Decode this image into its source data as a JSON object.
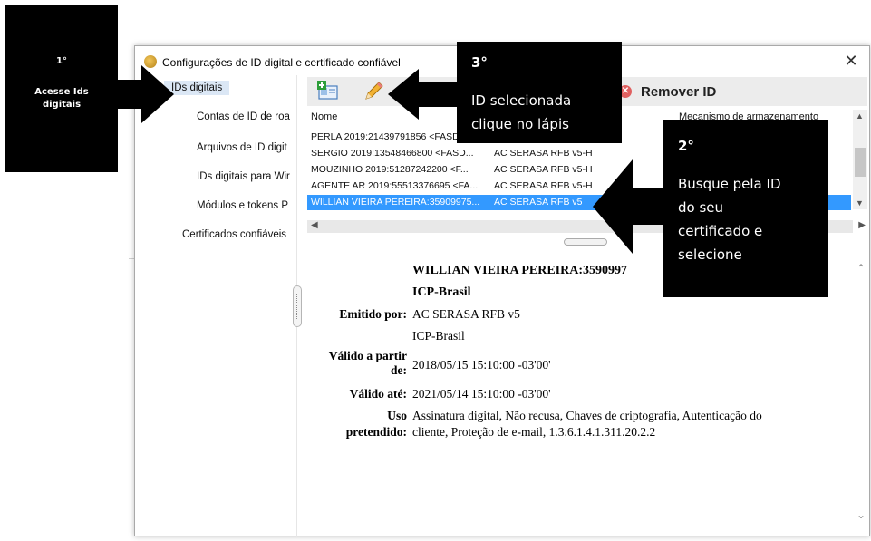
{
  "dialog": {
    "title": "Configurações de ID digital e certificado confiável",
    "close_label": "✕"
  },
  "nav": {
    "items": [
      {
        "label": "IDs digitais",
        "selected": true
      },
      {
        "label": "Contas de ID de roa"
      },
      {
        "label": "Arquivos de ID digit"
      },
      {
        "label": "IDs digitais para Wir"
      },
      {
        "label": "Módulos e tokens P"
      },
      {
        "label": "Certificados confiáveis"
      }
    ]
  },
  "toolbar": {
    "add_icon": "add-id-icon",
    "edit_icon": "pencil-icon",
    "remove_label": "Remover ID",
    "remove_icon": "x-circle-icon"
  },
  "list": {
    "columns": [
      "Nome",
      "Mecanismo de armazenamento"
    ],
    "rows": [
      {
        "name": "PERLA 2019:21439791856 <FASD...",
        "issuer": ""
      },
      {
        "name": "SERGIO 2019:13548466800 <FASD...",
        "issuer": "AC SERASA RFB v5-H"
      },
      {
        "name": "MOUZINHO 2019:51287242200 <F...",
        "issuer": "AC SERASA RFB v5-H"
      },
      {
        "name": "AGENTE AR 2019:55513376695 <FA...",
        "issuer": "AC SERASA RFB v5-H"
      },
      {
        "name": "WILLIAN VIEIRA PEREIRA:35909975...",
        "issuer": "AC SERASA RFB v5",
        "selected": true
      }
    ]
  },
  "details": {
    "name": "WILLIAN VIEIRA PEREIRA:3590997",
    "org": "ICP-Brasil",
    "issued_by_label": "Emitido por:",
    "issued_by_1": "AC SERASA RFB v5",
    "issued_by_2": "ICP-Brasil",
    "valid_from_label_1": "Válido a partir",
    "valid_from_label_2": "de:",
    "valid_from": "2018/05/15 15:10:00 -03'00'",
    "valid_to_label": "Válido até:",
    "valid_to": "2021/05/14 15:10:00 -03'00'",
    "usage_label_1": "Uso",
    "usage_label_2": "pretendido:",
    "usage_1": "Assinatura digital, Não recusa, Chaves de criptografia, Autenticação do",
    "usage_2": "cliente, Proteção de e-mail, 1.3.6.1.4.1.311.20.2.2"
  },
  "callouts": {
    "step1_num": "1°",
    "step1_text_1": "Acesse Ids",
    "step1_text_2": "digitais",
    "step2_num": "2°",
    "step2_text_1": "Busque pela ID",
    "step2_text_2": "do seu",
    "step2_text_3": "certificado e",
    "step2_text_4": "selecione",
    "step3_num": "3°",
    "step3_text_1": "ID selecionada",
    "step3_text_2": "clique no lápis",
    "color": "#000000"
  }
}
